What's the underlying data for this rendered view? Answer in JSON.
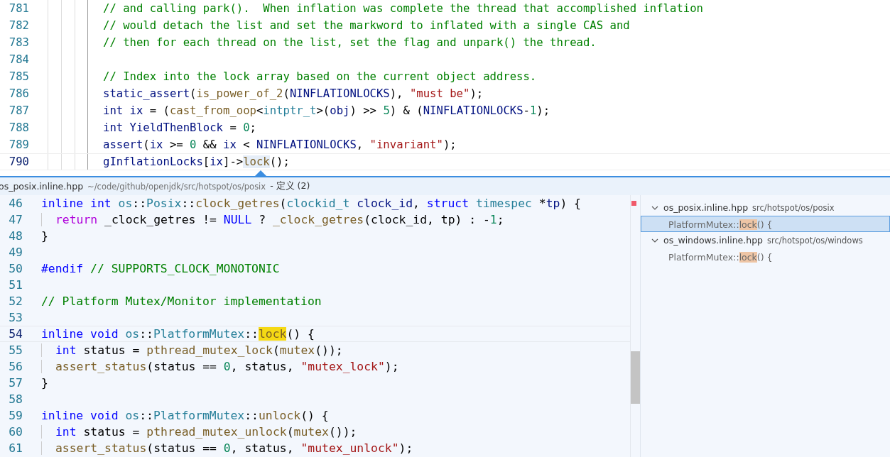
{
  "editor": {
    "lines": [
      {
        "number": "781",
        "current": false,
        "tokens": [
          {
            "kind": "comment",
            "text": "// and calling park().  When inflation was complete the thread that accomplished inflation"
          }
        ]
      },
      {
        "number": "782",
        "current": false,
        "tokens": [
          {
            "kind": "comment",
            "text": "// would detach the list and set the markword to inflated with a single CAS and"
          }
        ]
      },
      {
        "number": "783",
        "current": false,
        "tokens": [
          {
            "kind": "comment",
            "text": "// then for each thread on the list, set the flag and unpark() the thread."
          }
        ]
      },
      {
        "number": "784",
        "current": false
      },
      {
        "number": "785",
        "current": false,
        "tokens": [
          {
            "kind": "comment",
            "text": "// Index into the lock array based on the current object address."
          }
        ]
      },
      {
        "number": "786",
        "current": false,
        "tokens": [
          {
            "kind": "variable",
            "text": "static_assert"
          },
          {
            "kind": "plain",
            "text": "("
          },
          {
            "kind": "function",
            "text": "is_power_of_2"
          },
          {
            "kind": "plain",
            "text": "("
          },
          {
            "kind": "variable",
            "text": "NINFLATIONLOCKS"
          },
          {
            "kind": "plain",
            "text": "), "
          },
          {
            "kind": "string",
            "text": "\"must be\""
          },
          {
            "kind": "plain",
            "text": ");"
          }
        ]
      },
      {
        "number": "787",
        "current": false,
        "tokens": [
          {
            "kind": "variable",
            "text": "int ix"
          },
          {
            "kind": "plain",
            "text": " = ("
          },
          {
            "kind": "function",
            "text": "cast_from_oop"
          },
          {
            "kind": "plain",
            "text": "<"
          },
          {
            "kind": "type",
            "text": "intptr_t"
          },
          {
            "kind": "plain",
            "text": ">("
          },
          {
            "kind": "variable",
            "text": "obj"
          },
          {
            "kind": "plain",
            "text": ") >> "
          },
          {
            "kind": "number",
            "text": "5"
          },
          {
            "kind": "plain",
            "text": ") & ("
          },
          {
            "kind": "variable",
            "text": "NINFLATIONLOCKS"
          },
          {
            "kind": "plain",
            "text": "-"
          },
          {
            "kind": "number",
            "text": "1"
          },
          {
            "kind": "plain",
            "text": ");"
          }
        ]
      },
      {
        "number": "788",
        "current": false,
        "tokens": [
          {
            "kind": "variable",
            "text": "int YieldThenBlock"
          },
          {
            "kind": "plain",
            "text": " = "
          },
          {
            "kind": "number",
            "text": "0"
          },
          {
            "kind": "plain",
            "text": ";"
          }
        ]
      },
      {
        "number": "789",
        "current": false,
        "tokens": [
          {
            "kind": "variable",
            "text": "assert"
          },
          {
            "kind": "plain",
            "text": "("
          },
          {
            "kind": "variable",
            "text": "ix"
          },
          {
            "kind": "plain",
            "text": " >= "
          },
          {
            "kind": "number",
            "text": "0"
          },
          {
            "kind": "plain",
            "text": " && "
          },
          {
            "kind": "variable",
            "text": "ix"
          },
          {
            "kind": "plain",
            "text": " < "
          },
          {
            "kind": "variable",
            "text": "NINFLATIONLOCKS"
          },
          {
            "kind": "plain",
            "text": ", "
          },
          {
            "kind": "string",
            "text": "\"invariant\""
          },
          {
            "kind": "plain",
            "text": ");"
          }
        ]
      },
      {
        "number": "790",
        "current": true,
        "tokens": [
          {
            "kind": "variable",
            "text": "gInflationLocks"
          },
          {
            "kind": "plain",
            "text": "["
          },
          {
            "kind": "variable",
            "text": "ix"
          },
          {
            "kind": "plain",
            "text": "]->"
          },
          {
            "kind": "wordhl",
            "text": "lock"
          },
          {
            "kind": "plain",
            "text": "();"
          }
        ]
      }
    ]
  },
  "peek": {
    "header": {
      "file": "os_posix.inline.hpp",
      "path": "~/code/github/openjdk/src/hotspot/os/posix",
      "title": "- 定义 (2)"
    },
    "lines": [
      {
        "number": "46",
        "current": false,
        "tokens": [
          {
            "kind": "keyword",
            "text": "inline int "
          },
          {
            "kind": "type",
            "text": "os"
          },
          {
            "kind": "plain",
            "text": "::"
          },
          {
            "kind": "type",
            "text": "Posix"
          },
          {
            "kind": "plain",
            "text": "::"
          },
          {
            "kind": "function",
            "text": "clock_getres"
          },
          {
            "kind": "plain",
            "text": "("
          },
          {
            "kind": "type",
            "text": "clockid_t "
          },
          {
            "kind": "variable",
            "text": "clock_id"
          },
          {
            "kind": "plain",
            "text": ", "
          },
          {
            "kind": "keyword",
            "text": "struct "
          },
          {
            "kind": "type",
            "text": "timespec"
          },
          {
            "kind": "plain",
            "text": " *"
          },
          {
            "kind": "variable",
            "text": "tp"
          },
          {
            "kind": "plain",
            "text": ") {"
          }
        ]
      },
      {
        "number": "47",
        "current": false,
        "indented": true,
        "tokens": [
          {
            "kind": "control",
            "text": "return"
          },
          {
            "kind": "plain",
            "text": " _clock_getres != "
          },
          {
            "kind": "keyword",
            "text": "NULL"
          },
          {
            "kind": "plain",
            "text": " ? "
          },
          {
            "kind": "function",
            "text": "_clock_getres"
          },
          {
            "kind": "plain",
            "text": "(clock_id, tp) : -"
          },
          {
            "kind": "number",
            "text": "1"
          },
          {
            "kind": "plain",
            "text": ";"
          }
        ]
      },
      {
        "number": "48",
        "current": false,
        "tokens": [
          {
            "kind": "plain",
            "text": "}"
          }
        ]
      },
      {
        "number": "49",
        "current": false
      },
      {
        "number": "50",
        "current": false,
        "tokens": [
          {
            "kind": "keyword",
            "text": "#endif"
          },
          {
            "kind": "comment",
            "text": " // SUPPORTS_CLOCK_MONOTONIC"
          }
        ]
      },
      {
        "number": "51",
        "current": false
      },
      {
        "number": "52",
        "current": false,
        "tokens": [
          {
            "kind": "comment",
            "text": "// Platform Mutex/Monitor implementation"
          }
        ]
      },
      {
        "number": "53",
        "current": false
      },
      {
        "number": "54",
        "current": true,
        "tokens": [
          {
            "kind": "keyword",
            "text": "inline void "
          },
          {
            "kind": "type",
            "text": "os"
          },
          {
            "kind": "plain",
            "text": "::"
          },
          {
            "kind": "type",
            "text": "PlatformMutex"
          },
          {
            "kind": "plain",
            "text": "::"
          },
          {
            "kind": "match",
            "text": "lock"
          },
          {
            "kind": "plain",
            "text": "() {"
          }
        ]
      },
      {
        "number": "55",
        "current": false,
        "indented": true,
        "tokens": [
          {
            "kind": "keyword",
            "text": "int"
          },
          {
            "kind": "plain",
            "text": " status = "
          },
          {
            "kind": "function",
            "text": "pthread_mutex_lock"
          },
          {
            "kind": "plain",
            "text": "("
          },
          {
            "kind": "function",
            "text": "mutex"
          },
          {
            "kind": "plain",
            "text": "());"
          }
        ]
      },
      {
        "number": "56",
        "current": false,
        "indented": true,
        "tokens": [
          {
            "kind": "function",
            "text": "assert_status"
          },
          {
            "kind": "plain",
            "text": "(status == "
          },
          {
            "kind": "number",
            "text": "0"
          },
          {
            "kind": "plain",
            "text": ", status, "
          },
          {
            "kind": "string",
            "text": "\"mutex_lock\""
          },
          {
            "kind": "plain",
            "text": ");"
          }
        ]
      },
      {
        "number": "57",
        "current": false,
        "tokens": [
          {
            "kind": "plain",
            "text": "}"
          }
        ]
      },
      {
        "number": "58",
        "current": false
      },
      {
        "number": "59",
        "current": false,
        "tokens": [
          {
            "kind": "keyword",
            "text": "inline void "
          },
          {
            "kind": "type",
            "text": "os"
          },
          {
            "kind": "plain",
            "text": "::"
          },
          {
            "kind": "type",
            "text": "PlatformMutex"
          },
          {
            "kind": "plain",
            "text": "::"
          },
          {
            "kind": "function",
            "text": "unlock"
          },
          {
            "kind": "plain",
            "text": "() {"
          }
        ]
      },
      {
        "number": "60",
        "current": false,
        "indented": true,
        "tokens": [
          {
            "kind": "keyword",
            "text": "int"
          },
          {
            "kind": "plain",
            "text": " status = "
          },
          {
            "kind": "function",
            "text": "pthread_mutex_unlock"
          },
          {
            "kind": "plain",
            "text": "("
          },
          {
            "kind": "function",
            "text": "mutex"
          },
          {
            "kind": "plain",
            "text": "());"
          }
        ]
      },
      {
        "number": "61",
        "current": false,
        "indented": true,
        "tokens": [
          {
            "kind": "function",
            "text": "assert_status"
          },
          {
            "kind": "plain",
            "text": "(status == "
          },
          {
            "kind": "number",
            "text": "0"
          },
          {
            "kind": "plain",
            "text": ", status, "
          },
          {
            "kind": "string",
            "text": "\"mutex_unlock\""
          },
          {
            "kind": "plain",
            "text": ");"
          }
        ]
      }
    ],
    "references": [
      {
        "file": "os_posix.inline.hpp",
        "path": "src/hotspot/os/posix",
        "expanded": true,
        "children": [
          {
            "before": "PlatformMutex::",
            "match": "lock",
            "after": "() {",
            "selected": true
          }
        ]
      },
      {
        "file": "os_windows.inline.hpp",
        "path": "src/hotspot/os/windows",
        "expanded": true,
        "children": [
          {
            "before": "PlatformMutex::",
            "match": "lock",
            "after": "() {",
            "selected": false
          }
        ]
      }
    ]
  }
}
